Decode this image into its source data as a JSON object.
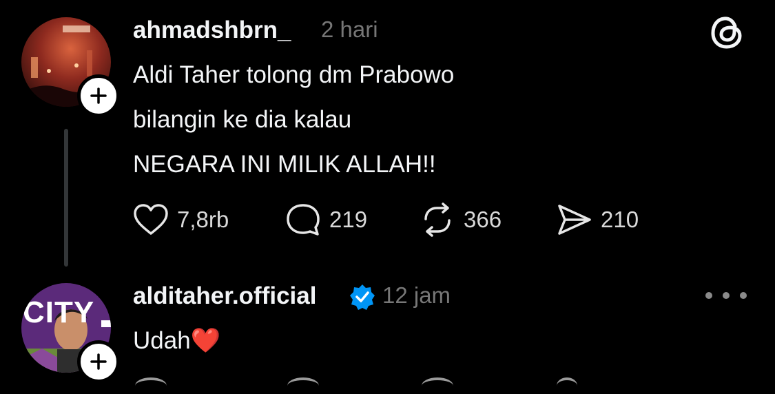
{
  "app": {
    "logo_icon": "threads-logo-icon"
  },
  "post": {
    "username": "ahmadshbrn_",
    "time": "2 hari",
    "text_lines": [
      "Aldi Taher tolong dm Prabowo",
      "bilangin ke dia kalau",
      "NEGARA INI MILIK ALLAH!!"
    ],
    "actions": {
      "likes": "7,8rb",
      "replies": "219",
      "reposts": "366",
      "shares": "210"
    }
  },
  "reply": {
    "username": "alditaher.official",
    "verified": true,
    "time": "12 jam",
    "text": "Udah",
    "emoji": "❤️",
    "avatar_text": "CITY"
  },
  "colors": {
    "background": "#000000",
    "text": "#f3f5f7",
    "secondary": "#777777",
    "verified": "#0095f6",
    "heart_emoji": "#e0202e"
  }
}
